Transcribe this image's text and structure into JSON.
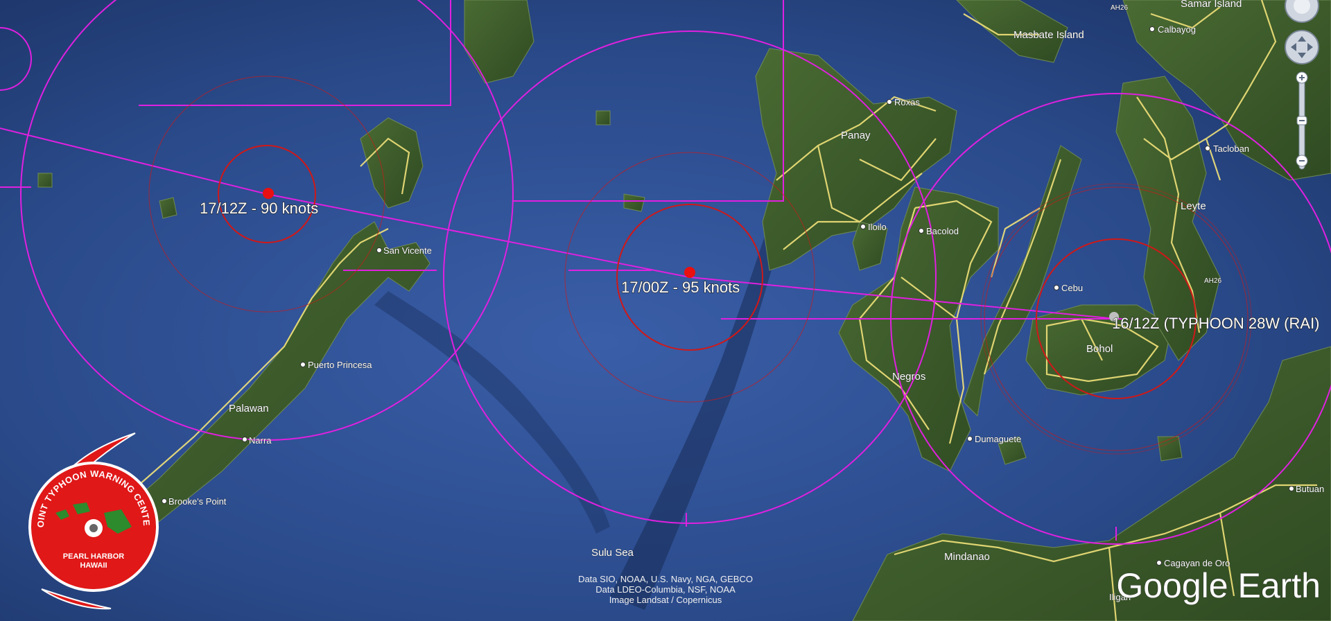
{
  "map": {
    "places": {
      "samar_island": "Samar Island",
      "masbate_island": "Masbate Island",
      "calbayog": "Calbayog",
      "roxas": "Roxas",
      "panay": "Panay",
      "tacloban": "Tacloban",
      "leyte": "Leyte",
      "iloilo": "Iloilo",
      "bacolod": "Bacolod",
      "san_vicente": "San Vicente",
      "cebu": "Cebu",
      "bohol": "Bohol",
      "negros": "Negros",
      "puerto_princesa": "Puerto Princesa",
      "palawan": "Palawan",
      "narra": "Narra",
      "dumaguete": "Dumaguete",
      "brookes_point": "Brooke's Point",
      "butuan": "Butuan",
      "sulu_sea": "Sulu Sea",
      "mindanao": "Mindanao",
      "cagayan_de_oro": "Cagayan de Oro",
      "iligan": "Iligan",
      "road_ah26_north": "AH26",
      "road_ah26_south": "AH26"
    },
    "forecast_points": [
      {
        "label": "17/12Z - 90 knots"
      },
      {
        "label": "17/00Z - 95 knots"
      },
      {
        "label": "16/12Z (TYPHOON 28W (RAI)"
      }
    ],
    "credits": [
      "Data SIO, NOAA, U.S. Navy, NGA, GEBCO",
      "Data LDEO-Columbia, NSF, NOAA",
      "Image Landsat / Copernicus"
    ],
    "logo": {
      "agency": "JOINT TYPHOON WARNING CENTER",
      "location_line1": "PEARL HARBOR",
      "location_line2": "HAWAII"
    },
    "brand": "Google Earth",
    "colors": {
      "ocean": "#2a4a8a",
      "land": "#3e5a2a",
      "roads": "#f2e27a",
      "danger_swath": "#e020e0",
      "wind_radii": "#e02020",
      "logo_red": "#e01818"
    }
  }
}
